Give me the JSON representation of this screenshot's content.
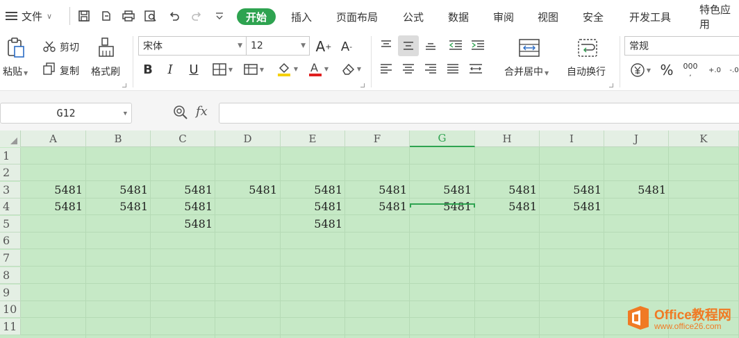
{
  "menu": {
    "file_label": "文件",
    "tabs": [
      {
        "label": "开始",
        "active": true
      },
      {
        "label": "插入"
      },
      {
        "label": "页面布局"
      },
      {
        "label": "公式"
      },
      {
        "label": "数据"
      },
      {
        "label": "审阅"
      },
      {
        "label": "视图"
      },
      {
        "label": "安全"
      },
      {
        "label": "开发工具"
      },
      {
        "label": "特色应用"
      }
    ]
  },
  "ribbon": {
    "paste": "粘贴",
    "cut": "剪切",
    "copy": "复制",
    "format_painter": "格式刷",
    "font_name": "宋体",
    "font_size": "12",
    "merge_center": "合并居中",
    "wrap_text": "自动换行",
    "number_format": "常规",
    "percent": "%",
    "thousands": "000",
    "inc_decimal": "+.0",
    "dec_decimal": "-.0"
  },
  "formula_bar": {
    "name_box": "G12",
    "fx": "fx",
    "formula": ""
  },
  "sheet": {
    "columns": [
      "A",
      "B",
      "C",
      "D",
      "E",
      "F",
      "G",
      "H",
      "I",
      "J",
      "K"
    ],
    "selected_column": "G",
    "rows": [
      "1",
      "2",
      "3",
      "4",
      "5",
      "6",
      "7",
      "8",
      "9",
      "10",
      "11"
    ],
    "cells": {
      "A3": "5481",
      "B3": "5481",
      "C3": "5481",
      "D3": "5481",
      "E3": "5481",
      "F3": "5481",
      "G3": "5481",
      "H3": "5481",
      "I3": "5481",
      "J3": "5481",
      "A4": "5481",
      "B4": "5481",
      "C4": "5481",
      "E4": "5481",
      "F4": "5481",
      "G4": "5481",
      "H4": "5481",
      "I4": "5481",
      "C5": "5481",
      "E5": "5481"
    },
    "fill_color": "#c6e9c6",
    "accent_color": "#2ea350"
  },
  "watermark": {
    "brand": "Office教程网",
    "url": "www.office26.com"
  }
}
